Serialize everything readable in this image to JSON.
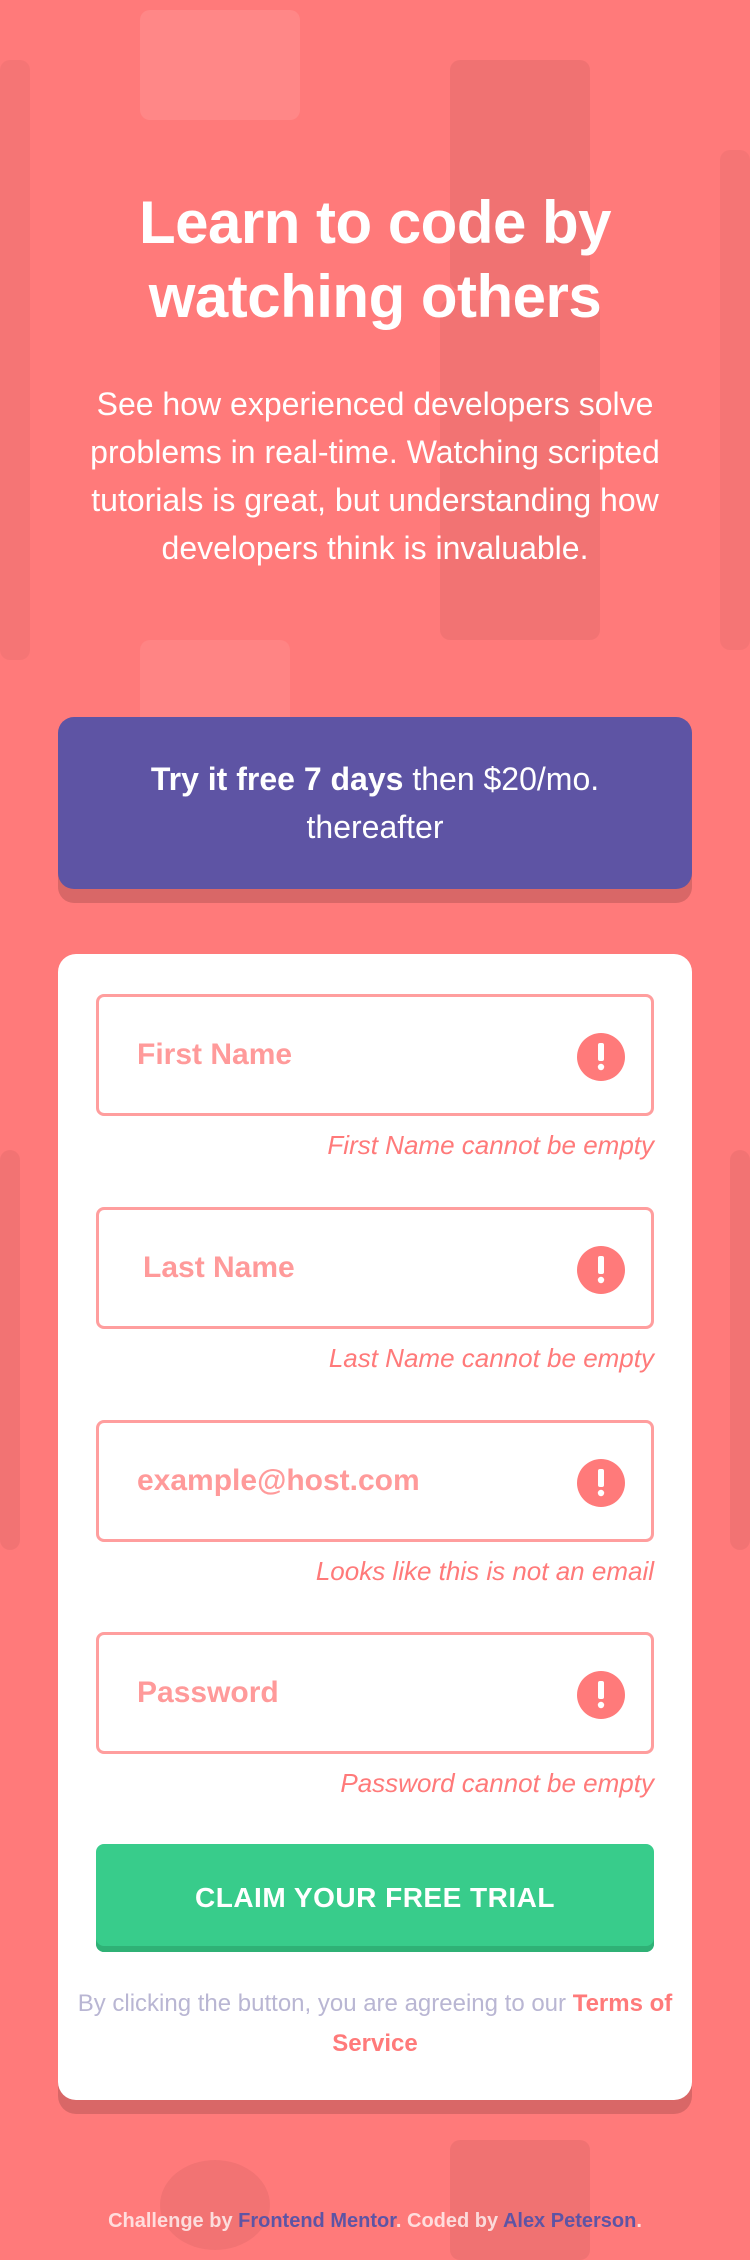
{
  "hero": {
    "title_line1": "Learn to code by",
    "title_line2": "watching others",
    "description": "See how experienced developers solve problems in real-time. Watching scripted tutorials is great, but understanding how developers think is invaluable."
  },
  "offer": {
    "bold": "Try it free 7 days",
    "rest": " then $20/mo. thereafter"
  },
  "form": {
    "fields": [
      {
        "placeholder": "First Name",
        "error": "First Name cannot be empty",
        "icon": "error-icon"
      },
      {
        "placeholder": "Last Name",
        "error": "Last Name cannot be empty",
        "icon": "error-icon"
      },
      {
        "placeholder": "example@host.com",
        "error": "Looks like this is not an email",
        "icon": "error-icon"
      },
      {
        "placeholder": "Password",
        "error": "Password cannot be empty",
        "icon": "error-icon"
      }
    ],
    "submit_label": "CLAIM YOUR FREE TRIAL",
    "terms_prefix": "By clicking the button, you are agreeing to our ",
    "terms_link": "Terms of Service"
  },
  "footer": {
    "challenge_prefix": "Challenge by ",
    "challenge_link": "Frontend Mentor",
    "coded_prefix": ". Coded by ",
    "author_link": "Alex Peterson",
    "suffix": "."
  },
  "colors": {
    "background": "#ff7a7a",
    "offer": "#5e54a4",
    "cta": "#38cc8b",
    "error": "#ff7a7a"
  }
}
